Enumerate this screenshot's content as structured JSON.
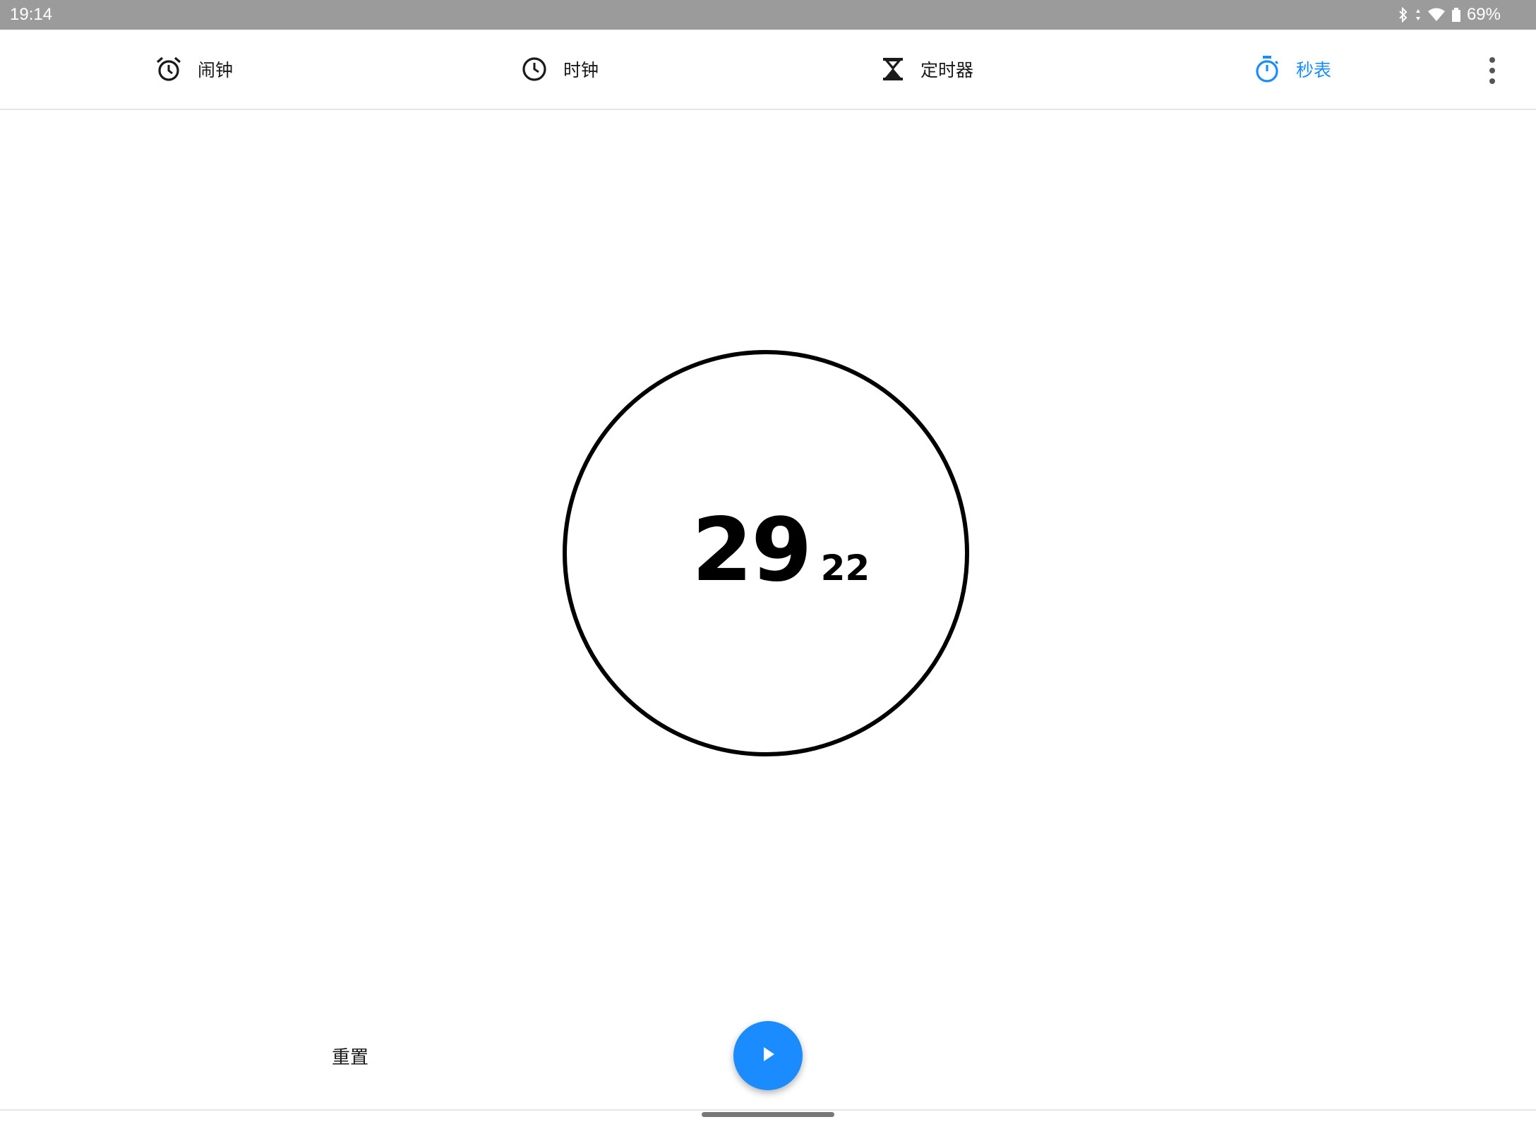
{
  "status_bar": {
    "time": "19:14",
    "battery": "69%",
    "icons": [
      "bluetooth-icon",
      "data-arrows-icon",
      "wifi-icon",
      "battery-icon"
    ]
  },
  "tabs": [
    {
      "label": "闹钟",
      "icon": "alarm-icon",
      "active": false
    },
    {
      "label": "时钟",
      "icon": "clock-icon",
      "active": false
    },
    {
      "label": "定时器",
      "icon": "hourglass-icon",
      "active": false
    },
    {
      "label": "秒表",
      "icon": "stopwatch-icon",
      "active": true
    }
  ],
  "colors": {
    "accent": "#1a8cff",
    "text": "#1a1a1a",
    "status_bar": "#9b9b9b"
  },
  "stopwatch": {
    "seconds": "29",
    "hundredths": "22"
  },
  "controls": {
    "reset_label": "重置",
    "play_icon": "play-icon"
  }
}
